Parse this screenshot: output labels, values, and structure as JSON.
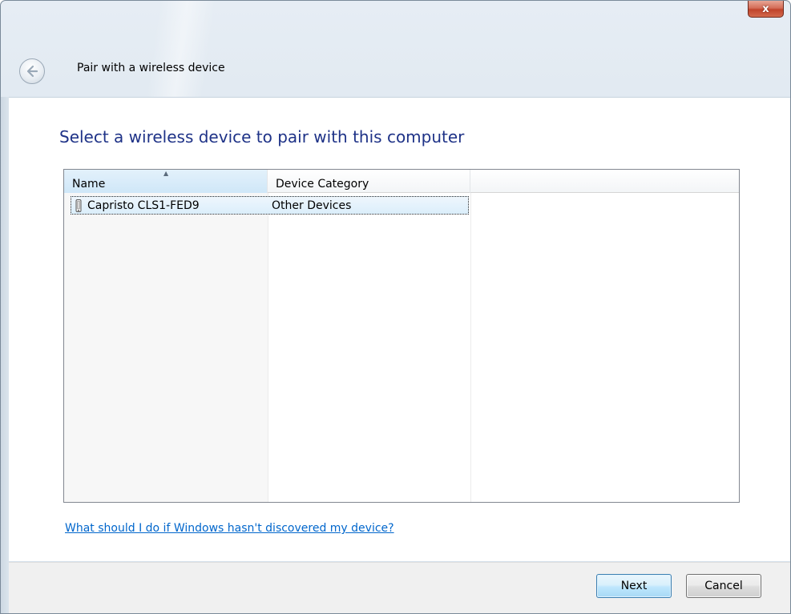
{
  "window": {
    "close_label": "x",
    "title": "Pair with a wireless device"
  },
  "main": {
    "heading": "Select a wireless device to pair with this computer",
    "columns": [
      {
        "label": "Name",
        "sorted": "ascending"
      },
      {
        "label": "Device Category"
      },
      {
        "label": ""
      }
    ],
    "devices": [
      {
        "name": "Capristo CLS1-FED9",
        "category": "Other Devices",
        "icon": "device-icon",
        "selected": true
      }
    ],
    "help_link": "What should I do if Windows hasn't discovered my device?"
  },
  "footer": {
    "next_label": "Next",
    "cancel_label": "Cancel"
  },
  "colors": {
    "heading": "#1e3287",
    "link": "#0066cc",
    "selection": "#dbeefb",
    "close": "#c0432b"
  }
}
